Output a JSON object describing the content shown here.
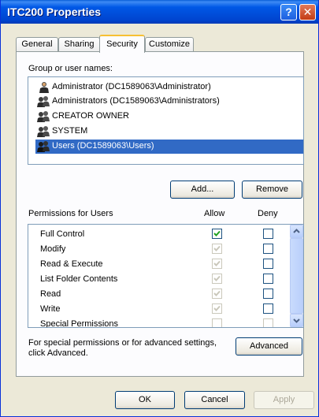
{
  "window": {
    "title": "ITC200 Properties"
  },
  "tabs": [
    {
      "label": "General"
    },
    {
      "label": "Sharing"
    },
    {
      "label": "Security",
      "active": true
    },
    {
      "label": "Customize"
    }
  ],
  "groups": {
    "label": "Group or user names:",
    "items": [
      {
        "name": "Administrator (DC1589063\\Administrator)",
        "icon": "user-icon"
      },
      {
        "name": "Administrators (DC1589063\\Administrators)",
        "icon": "group-icon"
      },
      {
        "name": "CREATOR OWNER",
        "icon": "group-icon"
      },
      {
        "name": "SYSTEM",
        "icon": "group-icon"
      },
      {
        "name": "Users (DC1589063\\Users)",
        "icon": "group-icon",
        "selected": true
      }
    ],
    "add_label": "Add...",
    "remove_label": "Remove"
  },
  "permissions": {
    "title": "Permissions for Users",
    "allow_header": "Allow",
    "deny_header": "Deny",
    "rows": [
      {
        "name": "Full Control",
        "allow": true,
        "allow_enabled": true,
        "deny": false
      },
      {
        "name": "Modify",
        "allow": true,
        "allow_enabled": false,
        "deny": false
      },
      {
        "name": "Read & Execute",
        "allow": true,
        "allow_enabled": false,
        "deny": false
      },
      {
        "name": "List Folder Contents",
        "allow": true,
        "allow_enabled": false,
        "deny": false
      },
      {
        "name": "Read",
        "allow": true,
        "allow_enabled": false,
        "deny": false
      },
      {
        "name": "Write",
        "allow": true,
        "allow_enabled": false,
        "deny": false
      },
      {
        "name": "Special Permissions",
        "allow": false,
        "allow_enabled": false,
        "deny": false
      }
    ]
  },
  "advanced": {
    "text_line1": "For special permissions or for advanced settings,",
    "text_line2": "click Advanced.",
    "button_label": "Advanced"
  },
  "footer": {
    "ok_label": "OK",
    "cancel_label": "Cancel",
    "apply_label": "Apply"
  },
  "colors": {
    "selection": "#316ac5",
    "titlebar": "#0058e6",
    "dialog_bg": "#ece9d8"
  }
}
